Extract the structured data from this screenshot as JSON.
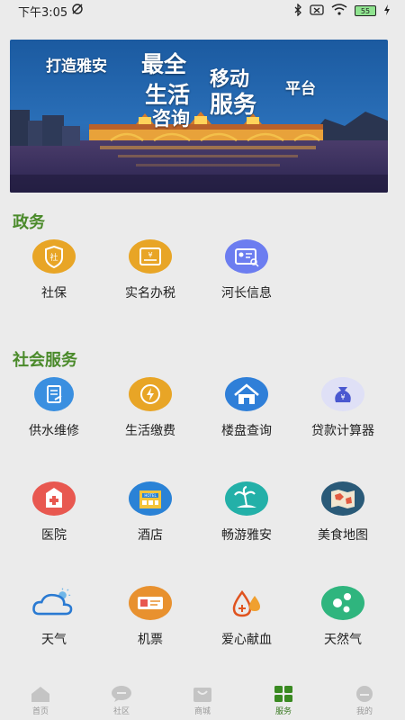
{
  "status_bar": {
    "time": "下午3:05",
    "battery": "55"
  },
  "banner": {
    "line1_prefix": "打造雅安",
    "big1": "最全",
    "big2": "移动",
    "big3": "生活",
    "big4": "服务",
    "platform": "平台",
    "sub": "咨询"
  },
  "sections": {
    "gov_title": "政务",
    "social_title": "社会服务"
  },
  "gov_items": [
    {
      "label": "社保",
      "icon": "shield-she-icon"
    },
    {
      "label": "实名办税",
      "icon": "tax-card-icon"
    },
    {
      "label": "河长信息",
      "icon": "id-search-icon"
    }
  ],
  "social_items": [
    {
      "label": "供水维修",
      "icon": "water-repair-icon"
    },
    {
      "label": "生活缴费",
      "icon": "bill-payment-icon"
    },
    {
      "label": "楼盘查询",
      "icon": "house-icon"
    },
    {
      "label": "贷款计算器",
      "icon": "money-bag-icon"
    },
    {
      "label": "医院",
      "icon": "hospital-icon"
    },
    {
      "label": "酒店",
      "icon": "hotel-icon"
    },
    {
      "label": "畅游雅安",
      "icon": "island-icon"
    },
    {
      "label": "美食地图",
      "icon": "map-icon"
    },
    {
      "label": "天气",
      "icon": "weather-icon"
    },
    {
      "label": "机票",
      "icon": "ticket-icon"
    },
    {
      "label": "爱心献血",
      "icon": "blood-drop-icon"
    },
    {
      "label": "天然气",
      "icon": "gas-icon"
    }
  ],
  "tabs": [
    {
      "label": "首页",
      "icon": "home-icon"
    },
    {
      "label": "社区",
      "icon": "chat-icon"
    },
    {
      "label": "商城",
      "icon": "shop-icon"
    },
    {
      "label": "服务",
      "icon": "grid-icon",
      "active": true
    },
    {
      "label": "我的",
      "icon": "profile-icon"
    }
  ],
  "colors": {
    "accent_green": "#4a8a2a",
    "tab_active": "#3a7a22",
    "background": "#ebebeb"
  }
}
